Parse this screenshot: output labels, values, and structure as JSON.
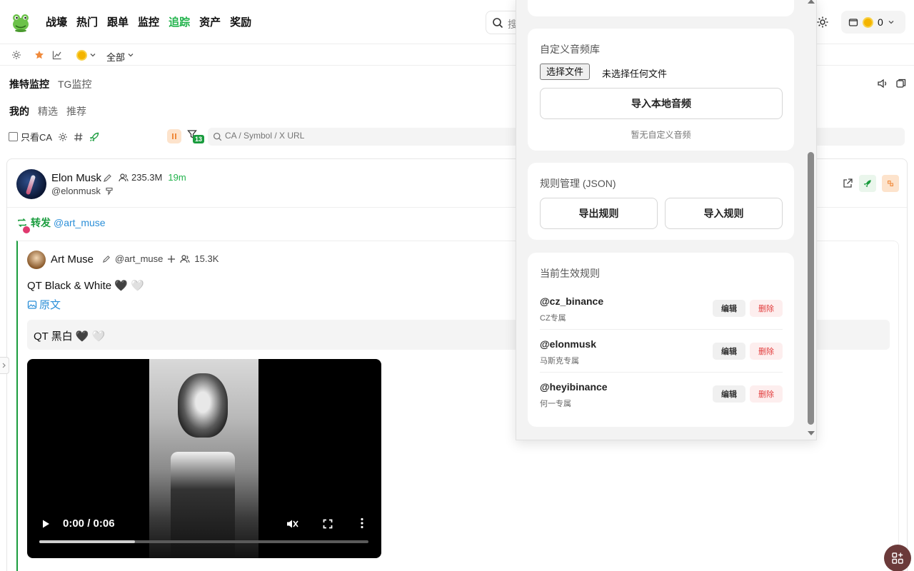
{
  "nav": {
    "items": [
      {
        "label": "战壕",
        "active": false
      },
      {
        "label": "热门",
        "active": false
      },
      {
        "label": "跟单",
        "active": false
      },
      {
        "label": "监控",
        "active": false
      },
      {
        "label": "追踪",
        "active": true
      },
      {
        "label": "资产",
        "active": false
      },
      {
        "label": "奖励",
        "active": false
      }
    ],
    "search_placeholder": "搜",
    "wallet_balance": "0"
  },
  "subbar": {
    "scope": "全部"
  },
  "tabs": {
    "primary": [
      {
        "label": "推特监控",
        "active": true
      },
      {
        "label": "TG监控",
        "active": false
      }
    ],
    "secondary": [
      {
        "label": "我的",
        "active": true
      },
      {
        "label": "精选",
        "active": false
      },
      {
        "label": "推荐",
        "active": false
      }
    ]
  },
  "filters": {
    "only_ca_label": "只看CA",
    "filter_count": "13",
    "search_placeholder": "CA / Symbol / X URL"
  },
  "post": {
    "author_name": "Elon Musk",
    "author_handle": "@elonmusk",
    "followers": "235.3M",
    "time": "19m",
    "retweet_label": "转发",
    "retweet_target": "@art_muse",
    "quote": {
      "author_name": "Art Muse",
      "author_handle": "@art_muse",
      "followers": "15.3K",
      "text": "QT Black & White 🖤 🤍",
      "original_label": "原文",
      "translation": "QT 黑白 🖤 🤍",
      "video_time": "0:00 / 0:06",
      "video_progress": 0.29
    }
  },
  "panel": {
    "audio_section": {
      "title": "自定义音频库",
      "choose_file": "选择文件",
      "no_file": "未选择任何文件",
      "import_button": "导入本地音频",
      "empty_text": "暂无自定义音频"
    },
    "rules_section": {
      "title": "规则管理 (JSON)",
      "export_button": "导出规则",
      "import_button": "导入规则"
    },
    "active_rules": {
      "title": "当前生效规则",
      "edit_label": "编辑",
      "delete_label": "删除",
      "items": [
        {
          "handle": "@cz_binance",
          "desc": "CZ专属"
        },
        {
          "handle": "@elonmusk",
          "desc": "马斯克专属"
        },
        {
          "handle": "@heyibinance",
          "desc": "何一专属"
        }
      ]
    }
  },
  "colors": {
    "accent": "#22b34c",
    "link": "#2b8fd8",
    "danger": "#e23b3b"
  }
}
